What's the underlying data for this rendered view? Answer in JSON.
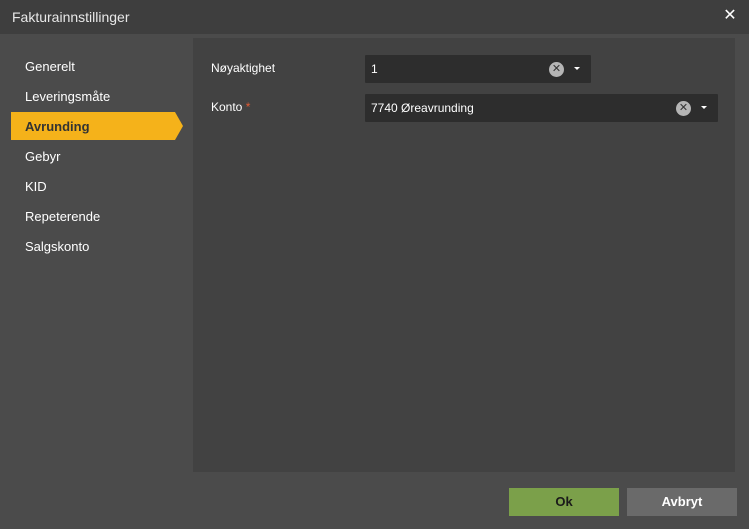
{
  "dialog": {
    "title": "Fakturainnstillinger",
    "close_icon": "close-icon"
  },
  "sidebar": {
    "items": [
      {
        "label": "Generelt",
        "active": false
      },
      {
        "label": "Leveringsmåte",
        "active": false
      },
      {
        "label": "Avrunding",
        "active": true
      },
      {
        "label": "Gebyr",
        "active": false
      },
      {
        "label": "KID",
        "active": false
      },
      {
        "label": "Repeterende",
        "active": false
      },
      {
        "label": "Salgskonto",
        "active": false
      }
    ]
  },
  "form": {
    "precision": {
      "label": "Nøyaktighet",
      "value": "1"
    },
    "account": {
      "label": "Konto",
      "required_marker": "*",
      "value": "7740 Øreavrunding"
    }
  },
  "footer": {
    "ok_label": "Ok",
    "cancel_label": "Avbryt"
  },
  "colors": {
    "accent": "#f5b21a",
    "ok": "#7ba04a",
    "required": "#e25a32"
  }
}
